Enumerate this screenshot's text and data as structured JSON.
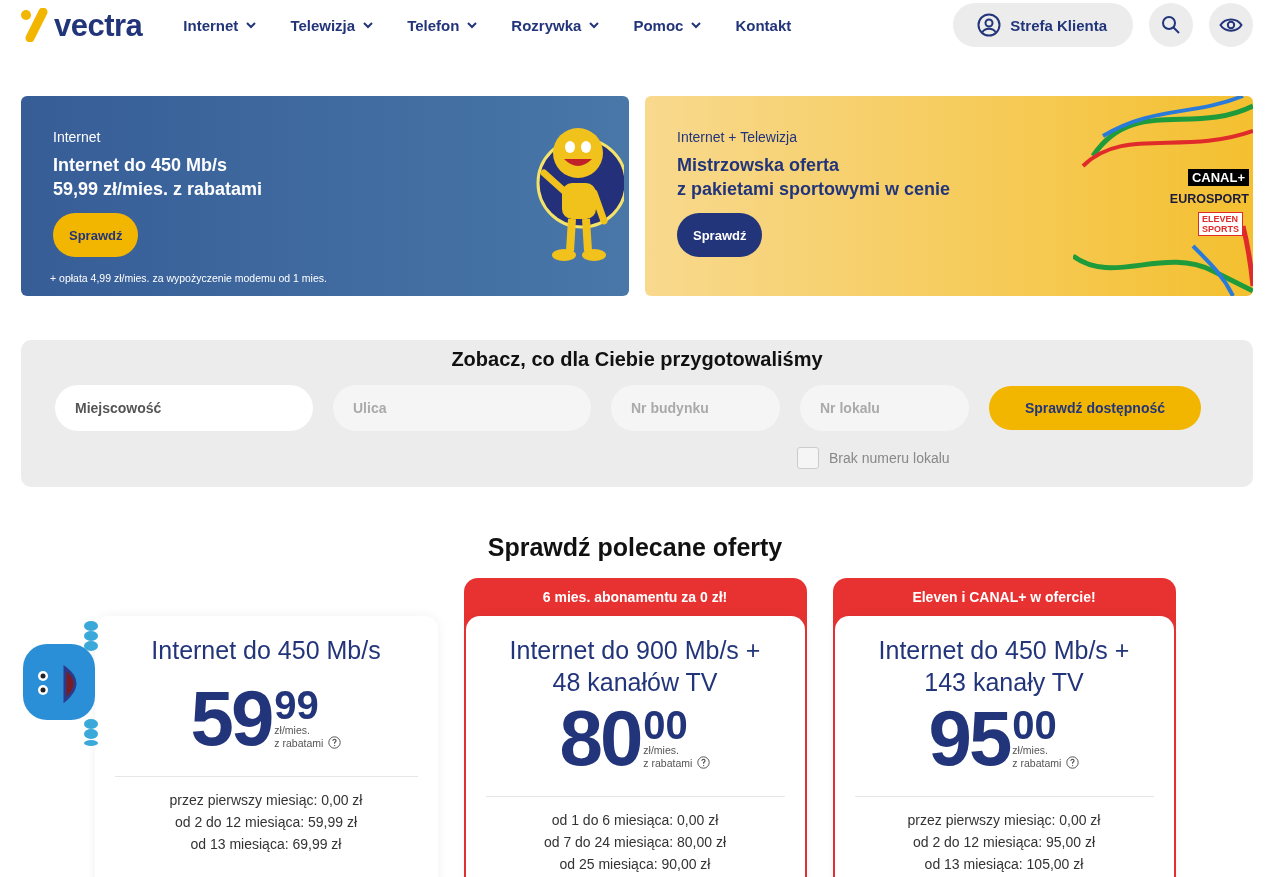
{
  "header": {
    "logo": "vectra",
    "nav": [
      {
        "label": "Internet",
        "dropdown": true
      },
      {
        "label": "Telewizja",
        "dropdown": true
      },
      {
        "label": "Telefon",
        "dropdown": true
      },
      {
        "label": "Rozrywka",
        "dropdown": true
      },
      {
        "label": "Pomoc",
        "dropdown": true
      },
      {
        "label": "Kontakt",
        "dropdown": false
      }
    ],
    "account_button": "Strefa Klienta"
  },
  "banners": [
    {
      "kind": "internet",
      "eyebrow": "Internet",
      "title_lines": [
        "Internet do 450 Mb/s",
        "59,99 zł/mies. z rabatami"
      ],
      "button": "Sprawdź",
      "footnote": "+ opłata 4,99 zł/mies. za wypożyczenie modemu od 1 mies."
    },
    {
      "kind": "sport",
      "eyebrow": "Internet + Telewizja",
      "title_lines": [
        "Mistrzowska oferta",
        "z pakietami sportowymi w cenie"
      ],
      "button": "Sprawdź",
      "logos": [
        "CANAL+",
        "EUROSPORT",
        "ELEVEN",
        "SPORTS"
      ]
    }
  ],
  "availability": {
    "title": "Zobacz, co dla Ciebie przygotowaliśmy",
    "fields": [
      {
        "placeholder": "Miejscowość",
        "enabled": true
      },
      {
        "placeholder": "Ulica",
        "enabled": false
      },
      {
        "placeholder": "Nr budynku",
        "enabled": false
      },
      {
        "placeholder": "Nr lokalu",
        "enabled": false
      }
    ],
    "button": "Sprawdź dostępność",
    "checkbox": {
      "label": "Brak numeru lokalu",
      "checked": false
    }
  },
  "offers": {
    "title": "Sprawdź polecane oferty",
    "cards": [
      {
        "mascot": true,
        "title_lines": [
          "Internet do 450 Mb/s"
        ],
        "price_main": "59",
        "price_cents": "99",
        "unit": "zł/mies.",
        "note": "z rabatami",
        "lines": [
          "przez pierwszy miesiąc: 0,00 zł",
          "od 2 do 12 miesiąca: 59,99 zł",
          "od 13 miesiąca: 69,99 zł"
        ]
      },
      {
        "mascot": false,
        "ribbon": "6 mies. abonamentu za 0 zł!",
        "title_lines": [
          "Internet do 900 Mb/s +",
          "48 kanałów TV"
        ],
        "price_main": "80",
        "price_cents": "00",
        "unit": "zł/mies.",
        "note": "z rabatami",
        "lines": [
          "od 1 do 6 miesiąca: 0,00 zł",
          "od 7 do 24 miesiąca: 80,00 zł",
          "od 25 miesiąca: 90,00 zł"
        ]
      },
      {
        "mascot": false,
        "ribbon": "Eleven i CANAL+ w ofercie!",
        "title_lines": [
          "Internet do 450 Mb/s +",
          "143 kanały TV"
        ],
        "price_main": "95",
        "price_cents": "00",
        "unit": "zł/mies.",
        "note": "z rabatami",
        "lines": [
          "przez pierwszy miesiąc: 0,00 zł",
          "od 2 do 12 miesiąca: 95,00 zł",
          "od 13 miesiąca: 105,00 zł"
        ]
      }
    ]
  }
}
